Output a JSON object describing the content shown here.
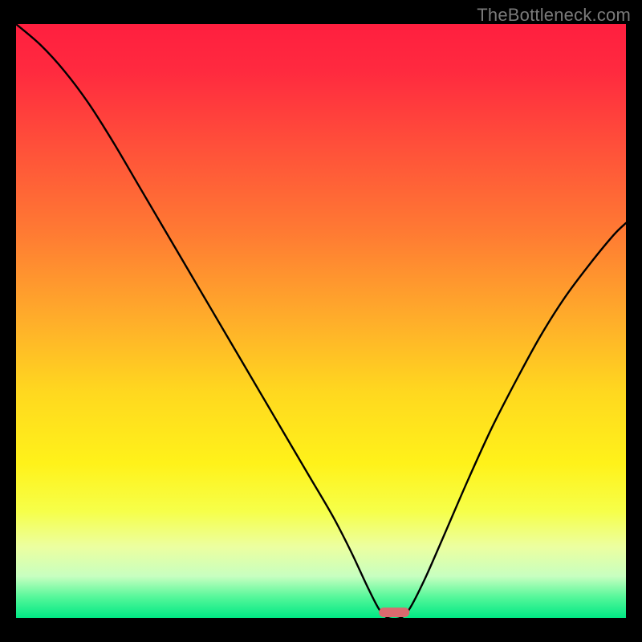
{
  "watermark": "TheBottleneck.com",
  "chart_data": {
    "type": "line",
    "title": "",
    "xlabel": "",
    "ylabel": "",
    "xlim": [
      0,
      100
    ],
    "ylim": [
      0,
      100
    ],
    "background_gradient": {
      "stops": [
        {
          "offset": 0.0,
          "color": "#ff1f3f"
        },
        {
          "offset": 0.08,
          "color": "#ff2a3f"
        },
        {
          "offset": 0.2,
          "color": "#ff4e3a"
        },
        {
          "offset": 0.35,
          "color": "#ff7a33"
        },
        {
          "offset": 0.5,
          "color": "#ffae2a"
        },
        {
          "offset": 0.62,
          "color": "#ffd81f"
        },
        {
          "offset": 0.74,
          "color": "#fff21a"
        },
        {
          "offset": 0.82,
          "color": "#f6ff49"
        },
        {
          "offset": 0.88,
          "color": "#ecffa0"
        },
        {
          "offset": 0.93,
          "color": "#c7ffc0"
        },
        {
          "offset": 0.965,
          "color": "#55f79a"
        },
        {
          "offset": 1.0,
          "color": "#00e884"
        }
      ]
    },
    "series": [
      {
        "name": "bottleneck-curve",
        "color": "#000000",
        "stroke_width": 2.4,
        "points": [
          {
            "x": 0.0,
            "y": 100.0
          },
          {
            "x": 4.0,
            "y": 96.5
          },
          {
            "x": 8.0,
            "y": 92.0
          },
          {
            "x": 12.0,
            "y": 86.5
          },
          {
            "x": 16.0,
            "y": 80.0
          },
          {
            "x": 20.0,
            "y": 73.0
          },
          {
            "x": 24.0,
            "y": 66.0
          },
          {
            "x": 28.0,
            "y": 59.0
          },
          {
            "x": 32.0,
            "y": 52.0
          },
          {
            "x": 36.0,
            "y": 45.0
          },
          {
            "x": 40.0,
            "y": 38.0
          },
          {
            "x": 44.0,
            "y": 31.0
          },
          {
            "x": 48.0,
            "y": 24.0
          },
          {
            "x": 52.0,
            "y": 17.0
          },
          {
            "x": 55.0,
            "y": 11.0
          },
          {
            "x": 57.5,
            "y": 5.5
          },
          {
            "x": 59.5,
            "y": 1.5
          },
          {
            "x": 61.0,
            "y": 0.0
          },
          {
            "x": 63.0,
            "y": 0.0
          },
          {
            "x": 64.5,
            "y": 1.5
          },
          {
            "x": 67.0,
            "y": 6.5
          },
          {
            "x": 70.0,
            "y": 13.5
          },
          {
            "x": 74.0,
            "y": 23.0
          },
          {
            "x": 78.0,
            "y": 32.0
          },
          {
            "x": 82.0,
            "y": 40.0
          },
          {
            "x": 86.0,
            "y": 47.5
          },
          {
            "x": 90.0,
            "y": 54.0
          },
          {
            "x": 94.0,
            "y": 59.5
          },
          {
            "x": 98.0,
            "y": 64.5
          },
          {
            "x": 100.0,
            "y": 66.5
          }
        ]
      }
    ],
    "marker": {
      "name": "bottleneck-marker",
      "color": "#d96a6f",
      "x_center": 62.0,
      "width": 5.0,
      "height": 1.6,
      "rx": 0.8
    }
  }
}
